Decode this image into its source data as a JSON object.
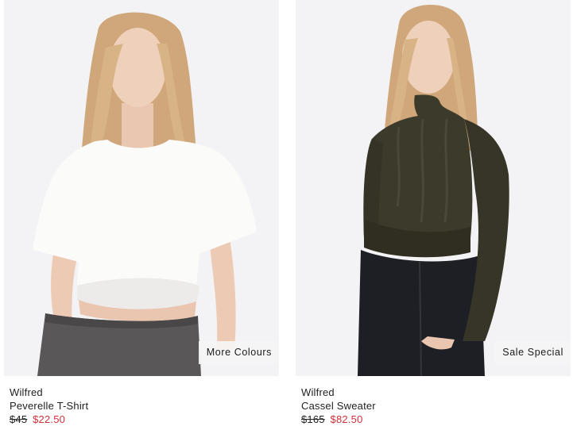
{
  "products": [
    {
      "badge": "More Colours",
      "brand": "Wilfred",
      "name": "Peverelle T-Shirt",
      "price_original": "$45",
      "price_sale": "$22.50"
    },
    {
      "badge": "Sale Special",
      "brand": "Wilfred",
      "name": "Cassel Sweater",
      "price_original": "$165",
      "price_sale": "$82.50"
    }
  ],
  "colors": {
    "image_background": "#f3f2f4",
    "sale_price": "#d0303a"
  }
}
